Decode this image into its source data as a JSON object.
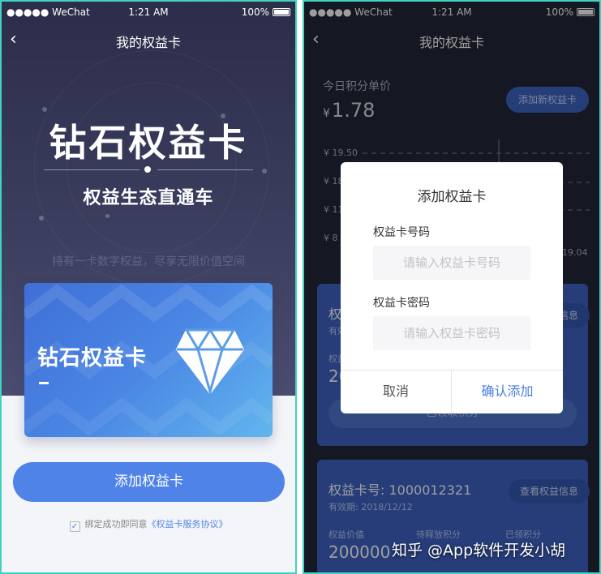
{
  "left": {
    "status": {
      "carrier": "●●●●● WeChat",
      "time": "1:21 AM",
      "battery": "100%"
    },
    "nav": {
      "title": "我的权益卡",
      "back_icon": "chevron-left-icon"
    },
    "hero": {
      "title": "钻石权益卡",
      "subtitle": "权益生态直通车",
      "description": "持有一卡数字权益，尽享无限价值空间"
    },
    "card": {
      "title": "钻石权益卡",
      "icon": "diamond-icon"
    },
    "add_button": "添加权益卡",
    "agreement": {
      "checked": true,
      "prefix": "绑定成功即同意",
      "link": "《权益卡服务协议》"
    },
    "colors": {
      "primary": "#5083e8",
      "hero_bg": "#2c2d4a",
      "accent_teal": "#3fd3c0"
    }
  },
  "right": {
    "status": {
      "carrier": "●●●●● WeChat",
      "time": "1:21 AM",
      "battery": "100%"
    },
    "nav": {
      "title": "我的权益卡",
      "back_icon": "chevron-left-icon"
    },
    "today_label": "今日积分单价",
    "price_currency": "¥",
    "price_value": "1.78",
    "add_new_button": "添加新权益卡",
    "chart_ticks": {
      "y1": "¥ 19.50",
      "y2": "¥ 18",
      "y3": "¥ 11",
      "y4": "¥ 8",
      "x_end": "19.04"
    },
    "card1": {
      "title": "权",
      "subtitle": "有效",
      "pill": "信息",
      "label": "权益",
      "value": "20",
      "action": "已领取积分"
    },
    "card2": {
      "title": "权益卡号: 1000012321",
      "expiry": "有效期: 2018/12/12",
      "pill": "查看权益信息",
      "labels": [
        "权益价值",
        "待释放积分",
        "已领积分"
      ],
      "value": "200000"
    },
    "modal": {
      "title": "添加权益卡",
      "number_label": "权益卡号码",
      "number_placeholder": "请输入权益卡号码",
      "password_label": "权益卡密码",
      "password_placeholder": "请输入权益卡密码",
      "cancel": "取消",
      "confirm": "确认添加"
    },
    "watermark": "知乎 @App软件开发小胡",
    "colors": {
      "confirm": "#4a7de0",
      "panel_bg": "#222638"
    }
  }
}
